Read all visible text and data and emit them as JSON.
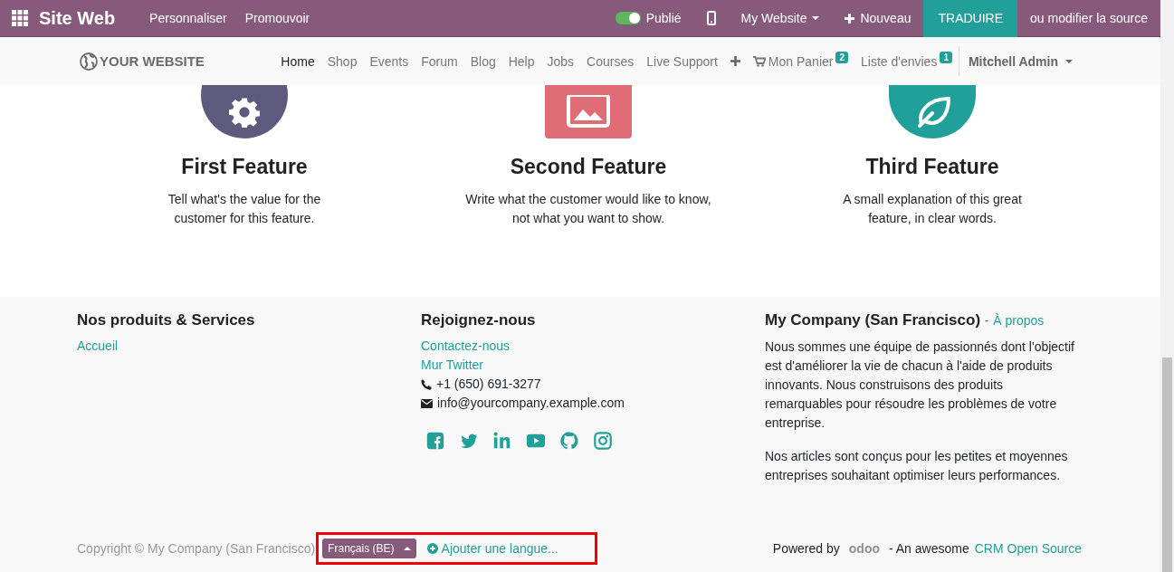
{
  "topbar": {
    "app_title": "Site Web",
    "menu": [
      "Personnaliser",
      "Promouvoir"
    ],
    "published": {
      "label": "Publié",
      "on": true
    },
    "website_menu": "My Website",
    "new_button": "Nouveau",
    "translate_button": "TRADUIRE",
    "edit_source": "ou modifier la source"
  },
  "navbar": {
    "logo": "YOUR WEBSITE",
    "items": [
      {
        "label": "Home",
        "selected": true
      },
      {
        "label": "Shop",
        "selected": false
      },
      {
        "label": "Events",
        "selected": false
      },
      {
        "label": "Forum",
        "selected": false
      },
      {
        "label": "Blog",
        "selected": false
      },
      {
        "label": "Help",
        "selected": false
      },
      {
        "label": "Jobs",
        "selected": false
      },
      {
        "label": "Courses",
        "selected": false
      },
      {
        "label": "Live Support",
        "selected": false
      }
    ],
    "cart": {
      "label": "Mon Panier",
      "count": "2"
    },
    "wishlist": {
      "label": "Liste d'envies",
      "count": "1"
    },
    "user": "Mitchell Admin"
  },
  "features": [
    {
      "kind": "gear",
      "color": "#5e5a7e",
      "title": "First Feature",
      "text": "Tell what's the value for the customer for this feature."
    },
    {
      "kind": "picture",
      "color": "#e06c75",
      "title": "Second Feature",
      "text": "Write what the customer would like to know, not what you want to show."
    },
    {
      "kind": "leaf",
      "color": "#21a09a",
      "title": "Third Feature",
      "text": "A small explanation of this great feature, in clear words."
    }
  ],
  "footer": {
    "products": {
      "title": "Nos produits & Services",
      "links": [
        "Accueil"
      ]
    },
    "contact": {
      "title": "Rejoignez-nous",
      "links": [
        "Contactez-nous",
        "Mur Twitter"
      ],
      "phone": "+1 (650) 691-3277",
      "email": "info@yourcompany.example.com"
    },
    "company": {
      "title": "My Company (San Francisco)",
      "separator": "-",
      "about_link": "À propos",
      "paragraphs": [
        "Nous sommes une équipe de passionnés dont l'objectif est d'améliorer la vie de chacun à l'aide de produits innovants. Nous construisons des produits remarquables pour résoudre les problèmes de votre entreprise.",
        "Nos articles sont conçus pour les petites et moyennes entreprises souhaitant optimiser leurs performances."
      ]
    }
  },
  "copyright": {
    "text": "Copyright © My Company (San Francisco)",
    "language": "Français (BE)",
    "add_language": "Ajouter une langue...",
    "powered_by": "Powered by",
    "brand": "odoo",
    "tagline": "- An awesome",
    "tagline_link": "CRM Open Source"
  }
}
